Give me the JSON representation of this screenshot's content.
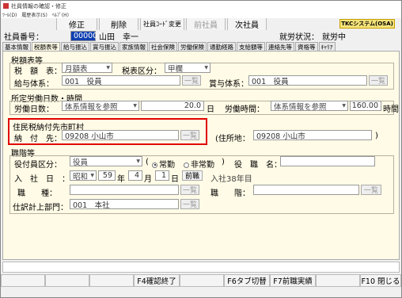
{
  "window": {
    "title": "社員情報の確認・修正",
    "menu": [
      "ﾂｰﾙ(D)",
      "履歴表示(S)",
      "ﾍﾙﾌﾟ(H)"
    ]
  },
  "toolbar": {
    "correct": "修正",
    "delete": "削除",
    "code_change": "社員ｺｰﾄﾞ変更",
    "prev": "前社員",
    "next": "次社員",
    "logo": "TKCシステム(OSA)"
  },
  "header": {
    "emp_no_label": "社員番号：",
    "emp_no": "000001",
    "name": "山田　幸一",
    "status_label": "就労状況：",
    "status": "就労中"
  },
  "tabs": [
    "基本情報",
    "税額表等",
    "給与振込",
    "賞与振込",
    "家族情報",
    "社会保険",
    "労働保険",
    "通勤経路",
    "支給額等",
    "連絡先等",
    "資格等",
    "ｷｬﾘｱ"
  ],
  "tax": {
    "title": "税額表等",
    "table_label": "税　額　表：",
    "table_value": "月額表",
    "division_label": "税表区分：",
    "division_value": "甲欄",
    "salary_label": "給与体系：",
    "salary_value": "001　役員",
    "bonus_label": "賞与体系：",
    "bonus_value": "001　役員",
    "list_button": "一覧"
  },
  "work": {
    "title": "所定労働日数・時間",
    "days_label": "労働日数：",
    "days_mode": "体系情報を参照",
    "days_value": "20.0",
    "days_unit": "日",
    "hours_label": "労働時間：",
    "hours_mode": "体系情報を参照",
    "hours_value": "160.00",
    "hours_unit": "時間"
  },
  "resident": {
    "title": "住民税納付先市町村",
    "pay_label": "納　付　先：",
    "pay_value": "09208 小山市",
    "list_button": "一覧",
    "address_label": "(住所地：",
    "address_value": "09208 小山市",
    "address_close": ")"
  },
  "position": {
    "title": "職階等",
    "officer_label": "役付員区分：",
    "officer_value": "役員",
    "radio_open": "(",
    "radio_full": "常勤",
    "radio_part": "非常勤",
    "radio_close": ")",
    "post_label": "役　職　名：",
    "join_label": "入　社　日　：",
    "era": "昭和",
    "year": "59",
    "year_unit": "年",
    "month": "4",
    "month_unit": "月",
    "day": "1",
    "day_unit": "日",
    "calendar_button": "前職",
    "tenure": "入社38年目",
    "job_label": "職　　種：",
    "rank_label": "職　　階：",
    "dept_label": "仕訳計上部門：",
    "dept_value": "001　本社",
    "list_button": "一覧"
  },
  "fkeys": [
    {
      "label": "",
      "w": 56
    },
    {
      "label": "",
      "w": 56
    },
    {
      "label": "",
      "w": 56
    },
    {
      "label": "F4確認終了",
      "w": 58
    },
    {
      "label": "",
      "w": 56
    },
    {
      "label": "F6タブ切替",
      "w": 58
    },
    {
      "label": "F7前職実績",
      "w": 58
    },
    {
      "label": "",
      "w": 56
    },
    {
      "label": "F10 閉じる",
      "w": 52
    }
  ]
}
